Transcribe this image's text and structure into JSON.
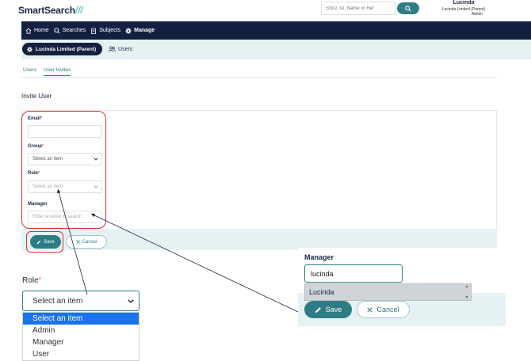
{
  "header": {
    "logo_text": "SmartSearch",
    "logo_slashes": "///",
    "search_placeholder": "SSID, ID, Name or Ref",
    "user_name": "Lucinda",
    "user_org": "Lucinda Limited (Parent)",
    "user_role": "Admin"
  },
  "nav": {
    "items": [
      {
        "label": "Home",
        "icon": "home-icon"
      },
      {
        "label": "Searches",
        "icon": "search-icon"
      },
      {
        "label": "Subjects",
        "icon": "clipboard-icon"
      },
      {
        "label": "Manage",
        "icon": "gear-icon"
      }
    ]
  },
  "subbar": {
    "org_label": "Lucinda Limited (Parent)",
    "users_label": "Users"
  },
  "tabs": [
    {
      "label": "Users",
      "active": false
    },
    {
      "label": "User Invites",
      "active": true
    }
  ],
  "page_title": "Invite User",
  "form": {
    "email_label": "Email",
    "group_label": "Group",
    "group_value": "Select an item",
    "role_label": "Role",
    "role_value": "Select an item",
    "manager_label": "Manager",
    "manager_placeholder": "Enter a name to search",
    "required_mark": "*",
    "save_label": "Save",
    "cancel_label": "Cancel"
  },
  "zoom_role": {
    "label": "Role",
    "required_mark": "*",
    "selected": "Select an item",
    "options": [
      "Select an item",
      "Admin",
      "Manager",
      "User"
    ]
  },
  "zoom_manager": {
    "label": "Manager",
    "input_value": "lucinda",
    "suggestion": "Lucinda",
    "save_label": "Save",
    "cancel_label": "Cancel"
  },
  "colors": {
    "navy": "#142040",
    "teal": "#2e7d86",
    "light_teal_bg": "#e6f1f3",
    "highlight_red": "#e03030",
    "selected_blue": "#1a73e8"
  }
}
